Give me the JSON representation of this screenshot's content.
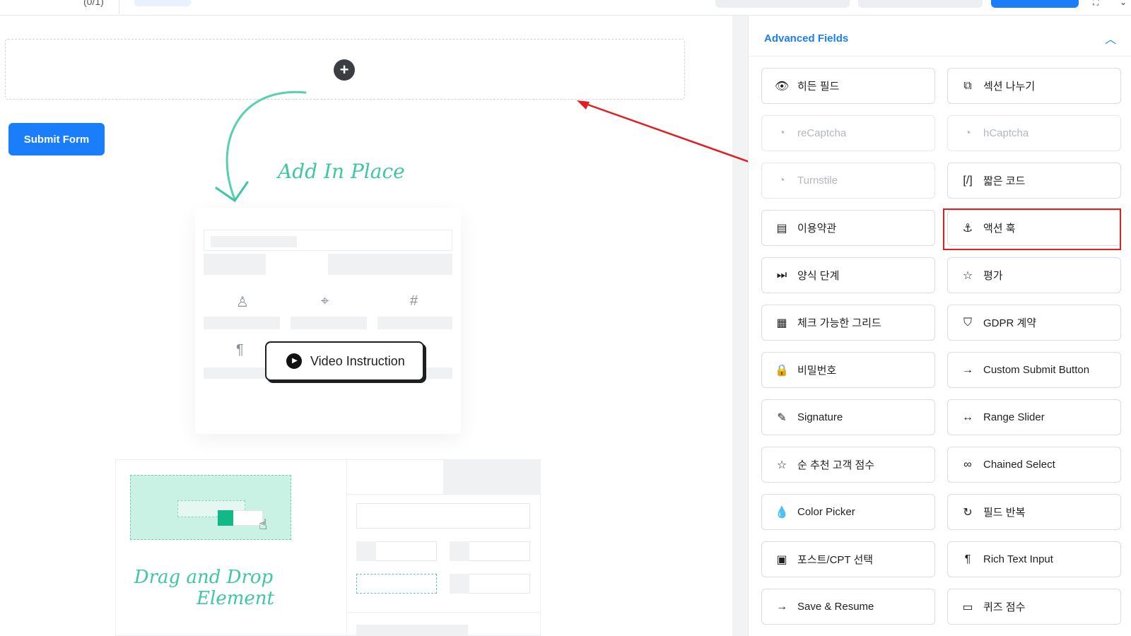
{
  "topbar": {
    "crumb": "(0/1)",
    "settings_icon": "expand-icon"
  },
  "canvas": {
    "submit_label": "Submit Form",
    "add_in_place": "Add In Place",
    "video_label": "Video Instruction",
    "drag_drop_line1": "Drag and Drop",
    "drag_drop_line2": "Element"
  },
  "panel": {
    "title": "Advanced Fields",
    "fields": [
      {
        "label": "히든 필드",
        "icon": "👁",
        "disabled": false
      },
      {
        "label": "섹션 나누기",
        "icon": "⧉",
        "disabled": false
      },
      {
        "label": "reCaptcha",
        "icon": "◔",
        "disabled": true
      },
      {
        "label": "hCaptcha",
        "icon": "◔",
        "disabled": true
      },
      {
        "label": "Turnstile",
        "icon": "◔",
        "disabled": true
      },
      {
        "label": "짧은 코드",
        "icon": "[/]",
        "disabled": false
      },
      {
        "label": "이용약관",
        "icon": "▤",
        "disabled": false
      },
      {
        "label": "액션 훅",
        "icon": "⚓",
        "disabled": false
      },
      {
        "label": "양식 단계",
        "icon": "⏭",
        "disabled": false
      },
      {
        "label": "평가",
        "icon": "☆",
        "disabled": false
      },
      {
        "label": "체크 가능한 그리드",
        "icon": "▦",
        "disabled": false
      },
      {
        "label": "GDPR 계약",
        "icon": "⛉",
        "disabled": false
      },
      {
        "label": "비밀번호",
        "icon": "🔒",
        "disabled": false
      },
      {
        "label": "Custom Submit Button",
        "icon": "→",
        "disabled": false
      },
      {
        "label": "Signature",
        "icon": "✎",
        "disabled": false
      },
      {
        "label": "Range Slider",
        "icon": "↔",
        "disabled": false
      },
      {
        "label": "순 추천 고객 점수",
        "icon": "☆",
        "disabled": false
      },
      {
        "label": "Chained Select",
        "icon": "∞",
        "disabled": false
      },
      {
        "label": "Color Picker",
        "icon": "💧",
        "disabled": false
      },
      {
        "label": "필드 반복",
        "icon": "↻",
        "disabled": false
      },
      {
        "label": "포스트/CPT 선택",
        "icon": "▣",
        "disabled": false
      },
      {
        "label": "Rich Text Input",
        "icon": "¶",
        "disabled": false
      },
      {
        "label": "Save & Resume",
        "icon": "→",
        "disabled": false
      },
      {
        "label": "퀴즈 점수",
        "icon": "▭",
        "disabled": false
      }
    ]
  },
  "annotation": {
    "highlight_target": "액션 훅",
    "arrow_color": "#e02020"
  }
}
